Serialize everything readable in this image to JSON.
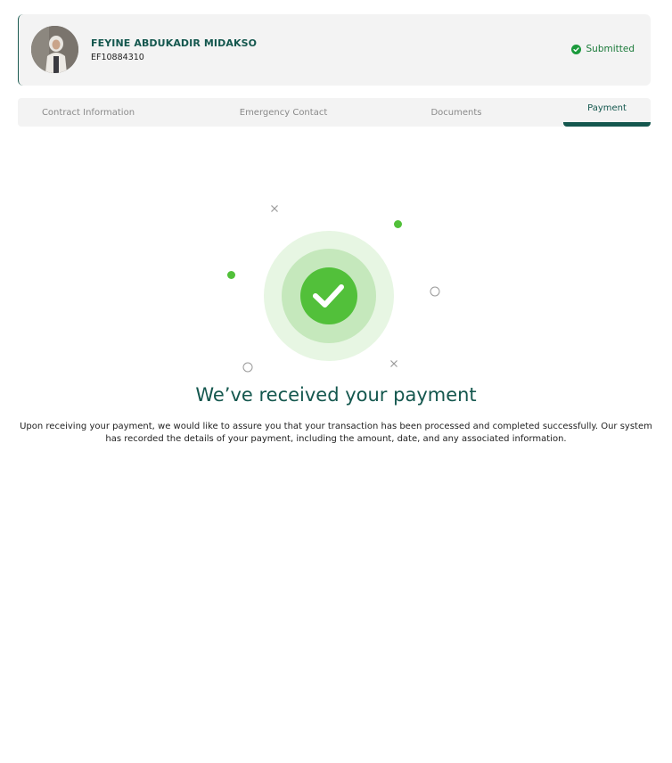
{
  "profile": {
    "name": "FEYINE ABDUKADIR MIDAKSO",
    "id": "EF10884310",
    "status": "Submitted",
    "status_color": "#1b7a3a"
  },
  "tabs": [
    {
      "label": "Contract Information",
      "active": false
    },
    {
      "label": "Emergency Contact",
      "active": false
    },
    {
      "label": "Documents",
      "active": false
    },
    {
      "label": "Payment",
      "active": true
    }
  ],
  "payment": {
    "title": "We’ve received your payment",
    "message": "Upon receiving your payment, we would like to assure you that your transaction has been processed and completed successfully. Our system has recorded the details of your payment, including the amount, date, and any associated information."
  },
  "colors": {
    "brand": "#14574e",
    "success": "#52c03a",
    "success_light": "#c5e8bc",
    "success_lighter": "#e7f6e3"
  },
  "icons": {
    "status": "check-circle-icon",
    "success": "check-icon"
  }
}
